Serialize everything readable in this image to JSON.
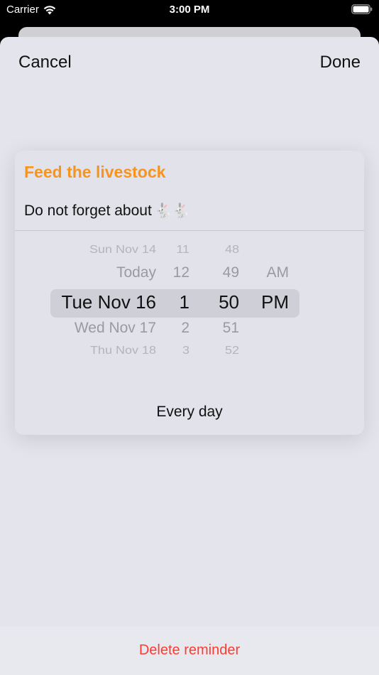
{
  "status_bar": {
    "carrier": "Carrier",
    "time": "3:00 PM"
  },
  "nav": {
    "cancel_label": "Cancel",
    "done_label": "Done"
  },
  "reminder": {
    "title": "Feed the livestock",
    "note": "Do not forget about",
    "note_emoji": "🐇🐇",
    "repeat": "Every day"
  },
  "picker": {
    "rows": [
      {
        "date": "Sun Nov 14",
        "hour": "11",
        "minute": "48",
        "ampm": ""
      },
      {
        "date": "Today",
        "hour": "12",
        "minute": "49",
        "ampm": "AM"
      },
      {
        "date": "Tue Nov 16",
        "hour": "1",
        "minute": "50",
        "ampm": "PM"
      },
      {
        "date": "Wed Nov 17",
        "hour": "2",
        "minute": "51",
        "ampm": ""
      },
      {
        "date": "Thu Nov 18",
        "hour": "3",
        "minute": "52",
        "ampm": ""
      }
    ]
  },
  "bottom": {
    "delete_label": "Delete reminder"
  },
  "colors": {
    "accent": "#f7941d",
    "destructive": "#ff3b30"
  },
  "icons": [
    "wifi-icon",
    "battery-icon",
    "rabbit-icon"
  ]
}
